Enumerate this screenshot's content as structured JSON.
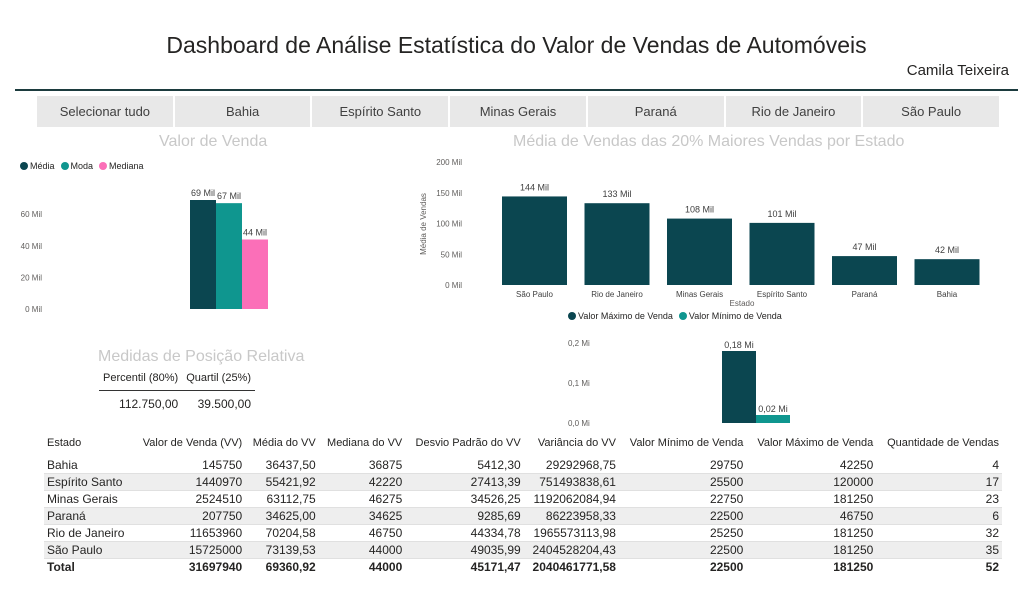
{
  "header": {
    "title": "Dashboard de Análise Estatística do Valor de Vendas de Automóveis",
    "author": "Camila Teixeira"
  },
  "slicer": {
    "items": [
      "Selecionar tudo",
      "Bahia",
      "Espírito Santo",
      "Minas Gerais",
      "Paraná",
      "Rio de Janeiro",
      "São Paulo"
    ]
  },
  "colors": {
    "dark_teal": "#0b4650",
    "teal": "#0f968f",
    "pink": "#fb6fb8"
  },
  "chart_data": [
    {
      "type": "bar",
      "title": "Valor de Venda",
      "categories": [
        ""
      ],
      "series": [
        {
          "name": "Média",
          "values": [
            69
          ],
          "label": "69 Mil",
          "color": "#0b4650"
        },
        {
          "name": "Moda",
          "values": [
            67
          ],
          "label": "67 Mil",
          "color": "#0f968f"
        },
        {
          "name": "Mediana",
          "values": [
            44
          ],
          "label": "44 Mil",
          "color": "#fb6fb8"
        }
      ],
      "yticks": [
        0,
        20,
        40,
        60
      ],
      "ytick_labels": [
        "0 Mil",
        "20 Mil",
        "40 Mil",
        "60 Mil"
      ],
      "ylim": [
        0,
        69
      ],
      "legend": "top-left"
    },
    {
      "type": "bar",
      "title": "Média de Vendas das 20% Maiores Vendas por Estado",
      "xlabel": "Estado",
      "ylabel": "Média de Vendas",
      "categories": [
        "São Paulo",
        "Rio de Janeiro",
        "Minas Gerais",
        "Espírito Santo",
        "Paraná",
        "Bahia"
      ],
      "values": [
        144,
        133,
        108,
        101,
        47,
        42
      ],
      "value_labels": [
        "144 Mil",
        "133 Mil",
        "108 Mil",
        "101 Mil",
        "47 Mil",
        "42 Mil"
      ],
      "yticks": [
        0,
        50,
        100,
        150,
        200
      ],
      "ytick_labels": [
        "0 Mil",
        "50 Mil",
        "100 Mil",
        "150 Mil",
        "200 Mil"
      ],
      "ylim": [
        0,
        200
      ],
      "color": "#0b4650"
    },
    {
      "type": "bar",
      "categories": [
        ""
      ],
      "series": [
        {
          "name": "Valor Máximo de Venda",
          "values": [
            0.18
          ],
          "label": "0,18 Mi",
          "color": "#0b4650"
        },
        {
          "name": "Valor Mínimo de Venda",
          "values": [
            0.02
          ],
          "label": "0,02 Mi",
          "color": "#0f968f"
        }
      ],
      "yticks": [
        0,
        0.1,
        0.2
      ],
      "ytick_labels": [
        "0,0 Mi",
        "0,1 Mi",
        "0,2 Mi"
      ],
      "ylim": [
        0,
        0.2
      ],
      "legend": "top-left"
    }
  ],
  "position_measures": {
    "title": "Medidas de Posição Relativa",
    "headers": [
      "Percentil (80%)",
      "Quartil (25%)"
    ],
    "values": [
      "112.750,00",
      "39.500,00"
    ]
  },
  "stats_table": {
    "headers": [
      "Estado",
      "Valor de Venda (VV)",
      "Média do VV",
      "Mediana do VV",
      "Desvio Padrão do VV",
      "Variância do VV",
      "Valor Mínimo de Venda",
      "Valor Máximo de Venda",
      "Quantidade de Vendas"
    ],
    "rows": [
      [
        "Bahia",
        "145750",
        "36437,50",
        "36875",
        "5412,30",
        "29292968,75",
        "29750",
        "42250",
        "4"
      ],
      [
        "Espírito Santo",
        "1440970",
        "55421,92",
        "42220",
        "27413,39",
        "751493838,61",
        "25500",
        "120000",
        "17"
      ],
      [
        "Minas Gerais",
        "2524510",
        "63112,75",
        "46275",
        "34526,25",
        "1192062084,94",
        "22750",
        "181250",
        "23"
      ],
      [
        "Paraná",
        "207750",
        "34625,00",
        "34625",
        "9285,69",
        "86223958,33",
        "22500",
        "46750",
        "6"
      ],
      [
        "Rio de Janeiro",
        "11653960",
        "70204,58",
        "46750",
        "44334,78",
        "1965573113,98",
        "25250",
        "181250",
        "32"
      ],
      [
        "São Paulo",
        "15725000",
        "73139,53",
        "44000",
        "49035,99",
        "2404528204,43",
        "22500",
        "181250",
        "35"
      ]
    ],
    "total": [
      "Total",
      "31697940",
      "69360,92",
      "44000",
      "45171,47",
      "2040461771,58",
      "22500",
      "181250",
      "52"
    ]
  }
}
